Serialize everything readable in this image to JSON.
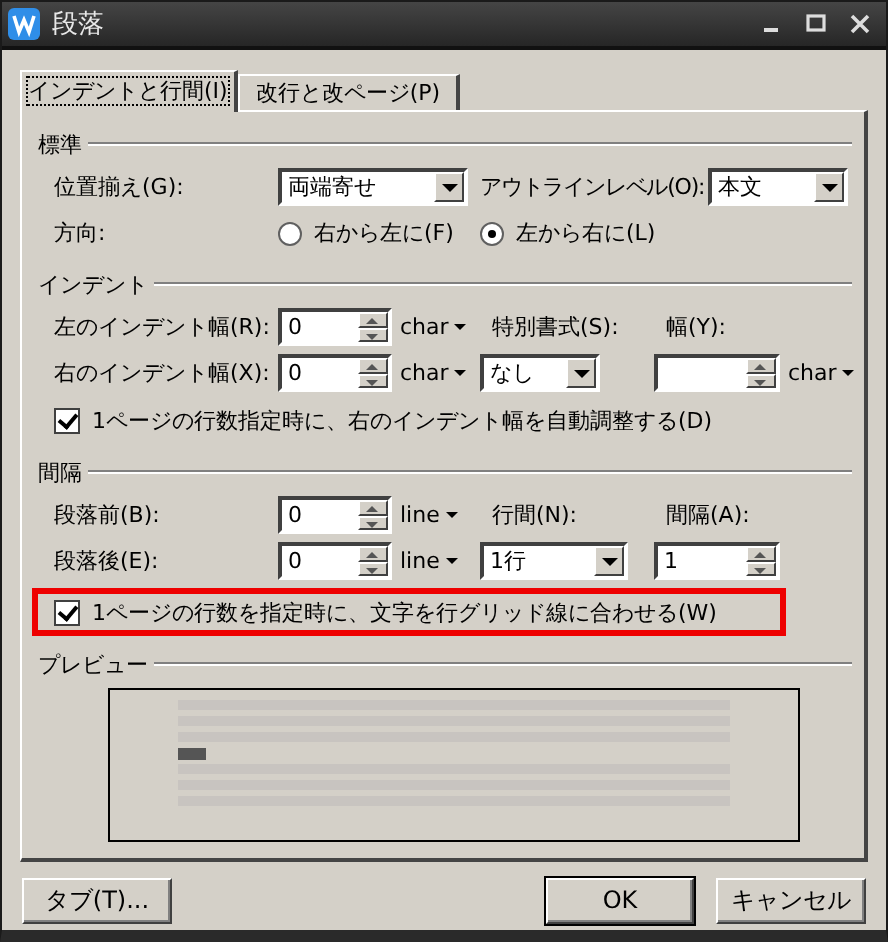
{
  "window": {
    "title": "段落"
  },
  "tabs": [
    {
      "label": "インデントと行間(I)",
      "selected": true
    },
    {
      "label": "改行と改ページ(P)",
      "selected": false
    }
  ],
  "general": {
    "title": "標準",
    "alignment": {
      "label": "位置揃え(G):",
      "value": "両端寄せ"
    },
    "outline": {
      "label": "アウトラインレベル(O):",
      "value": "本文"
    },
    "direction": {
      "label": "方向:",
      "options": [
        {
          "label": "右から左に(F)",
          "selected": false
        },
        {
          "label": "左から右に(L)",
          "selected": true
        }
      ]
    }
  },
  "indent": {
    "title": "インデント",
    "left": {
      "label": "左のインデント幅(R):",
      "value": "0",
      "unit": "char"
    },
    "right": {
      "label": "右のインデント幅(X):",
      "value": "0",
      "unit": "char"
    },
    "special": {
      "label": "特別書式(S):",
      "value": "なし"
    },
    "width": {
      "label": "幅(Y):",
      "unit": "char"
    },
    "auto_adjust": {
      "label": "1ページの行数指定時に、右のインデント幅を自動調整する(D)",
      "checked": true
    }
  },
  "spacing": {
    "title": "間隔",
    "before": {
      "label": "段落前(B):",
      "value": "0",
      "unit": "line"
    },
    "after": {
      "label": "段落後(E):",
      "value": "0",
      "unit": "line"
    },
    "line_spacing": {
      "label": "行間(N):",
      "value": "1行"
    },
    "at": {
      "label": "間隔(A):",
      "value": "1"
    },
    "snap_to_grid": {
      "label": "1ページの行数を指定時に、文字を行グリッド線に合わせる(W)",
      "checked": true,
      "highlighted": true
    }
  },
  "preview": {
    "title": "プレビュー"
  },
  "buttons": [
    {
      "label": "タブ(T)...",
      "kind": "normal"
    },
    {
      "label": "OK",
      "kind": "default"
    },
    {
      "label": "キャンセル",
      "kind": "normal"
    }
  ]
}
